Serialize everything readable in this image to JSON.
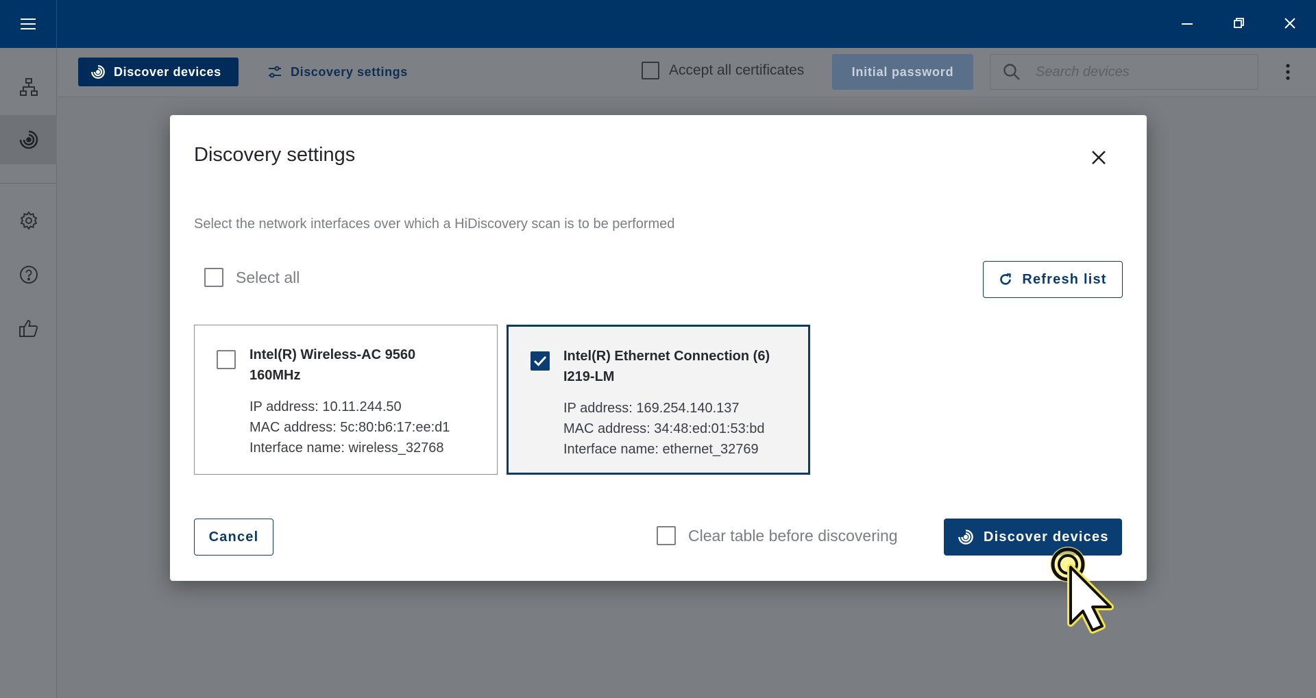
{
  "toolbar": {
    "discover_label": "Discover devices",
    "settings_label": "Discovery settings",
    "accept_certs_label": "Accept all certificates",
    "initial_password_label": "Initial password",
    "search_placeholder": "Search devices"
  },
  "sidebar": {
    "items": [
      {
        "icon": "network-topology-icon"
      },
      {
        "icon": "discovery-radar-icon",
        "active": true
      },
      {
        "icon": "gear-icon"
      },
      {
        "icon": "help-icon"
      },
      {
        "icon": "thumbs-up-icon"
      }
    ]
  },
  "dialog": {
    "title": "Discovery settings",
    "description": "Select the network interfaces over which a HiDiscovery scan is to be performed",
    "select_all_label": "Select all",
    "refresh_label": "Refresh list",
    "interfaces": [
      {
        "name_line1": "Intel(R) Wireless-AC 9560",
        "name_line2": "160MHz",
        "ip": "IP address: 10.11.244.50",
        "mac": "MAC address: 5c:80:b6:17:ee:d1",
        "iface": "Interface name: wireless_32768",
        "selected": false
      },
      {
        "name_line1": "Intel(R) Ethernet Connection (6)",
        "name_line2": "I219-LM",
        "ip": "IP address: 169.254.140.137",
        "mac": "MAC address: 34:48:ed:01:53:bd",
        "iface": "Interface name: ethernet_32769",
        "selected": true
      }
    ],
    "cancel_label": "Cancel",
    "clear_table_label": "Clear table before discovering",
    "discover_label": "Discover devices"
  },
  "colors": {
    "brand": "#003366",
    "primary_button": "#0a3d72",
    "overlay": "#7a7d81"
  }
}
